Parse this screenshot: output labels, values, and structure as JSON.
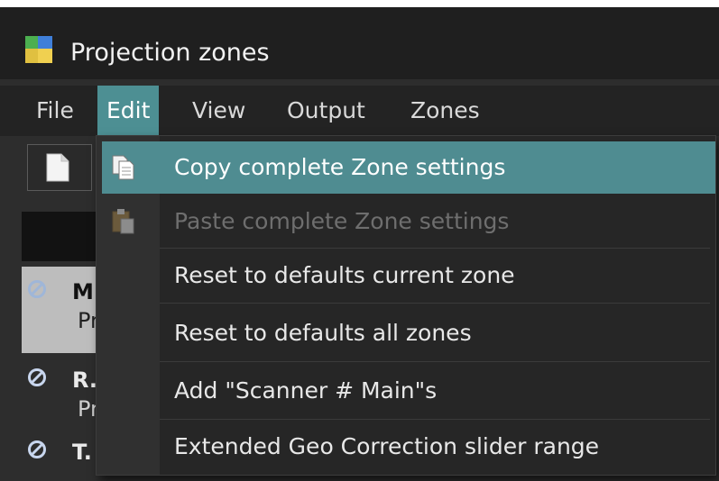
{
  "window": {
    "title": "Projection zones",
    "icon": "projection-zones-app-icon"
  },
  "menubar": {
    "items": [
      {
        "label": "File"
      },
      {
        "label": "Edit",
        "active": true
      },
      {
        "label": "View"
      },
      {
        "label": "Output"
      },
      {
        "label": "Zones"
      }
    ]
  },
  "edit_menu": {
    "items": [
      {
        "label": "Copy complete Zone settings",
        "icon": "copy-icon",
        "highlighted": true,
        "enabled": true
      },
      {
        "label": "Paste complete Zone settings",
        "icon": "paste-icon",
        "highlighted": false,
        "enabled": false
      },
      {
        "label": "Reset to defaults current zone",
        "enabled": true
      },
      {
        "label": "Reset to defaults all zones",
        "enabled": true
      },
      {
        "label": "Add \"Scanner # Main\"s",
        "enabled": true
      },
      {
        "label": "Extended Geo Correction slider range",
        "enabled": true
      }
    ]
  },
  "zones_list": {
    "items": [
      {
        "title": "M",
        "subtitle": "Pr",
        "icon": "disabled-circle-icon",
        "selected": true
      },
      {
        "title": "R.",
        "subtitle": "Pr",
        "icon": "disabled-circle-icon",
        "selected": false
      },
      {
        "title": "T.",
        "subtitle": "",
        "icon": "disabled-circle-icon",
        "selected": false
      }
    ]
  },
  "colors": {
    "accent": "#4f8c91",
    "menu_bg": "#262626",
    "titlebar_bg": "#1f1f1f"
  }
}
